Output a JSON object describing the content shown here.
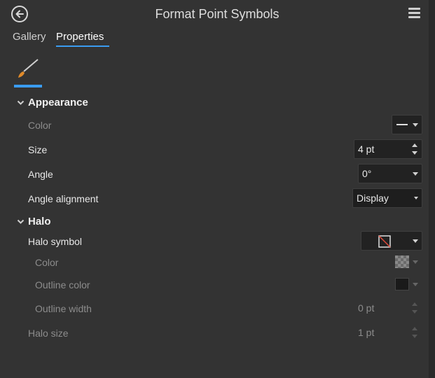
{
  "header": {
    "title": "Format Point Symbols",
    "back_icon": "back-arrow-icon",
    "menu_icon": "hamburger-menu-icon"
  },
  "tabs": [
    {
      "label": "Gallery",
      "active": false
    },
    {
      "label": "Properties",
      "active": true
    }
  ],
  "sub_tab": {
    "icon": "paintbrush-icon",
    "active": true
  },
  "appearance": {
    "heading": "Appearance",
    "color_label": "Color",
    "size_label": "Size",
    "size_value": "4 pt",
    "angle_label": "Angle",
    "angle_value": "0°",
    "angle_alignment_label": "Angle alignment",
    "angle_alignment_value": "Display"
  },
  "halo": {
    "heading": "Halo",
    "symbol_label": "Halo symbol",
    "color_label": "Color",
    "outline_color_label": "Outline color",
    "outline_width_label": "Outline width",
    "outline_width_value": "0 pt",
    "size_label": "Halo size",
    "size_value": "1 pt"
  },
  "colors": {
    "accent": "#3a9cf0",
    "panel_bg": "#333333",
    "control_bg": "#222222",
    "no_symbol_slash": "#e04a3a"
  }
}
